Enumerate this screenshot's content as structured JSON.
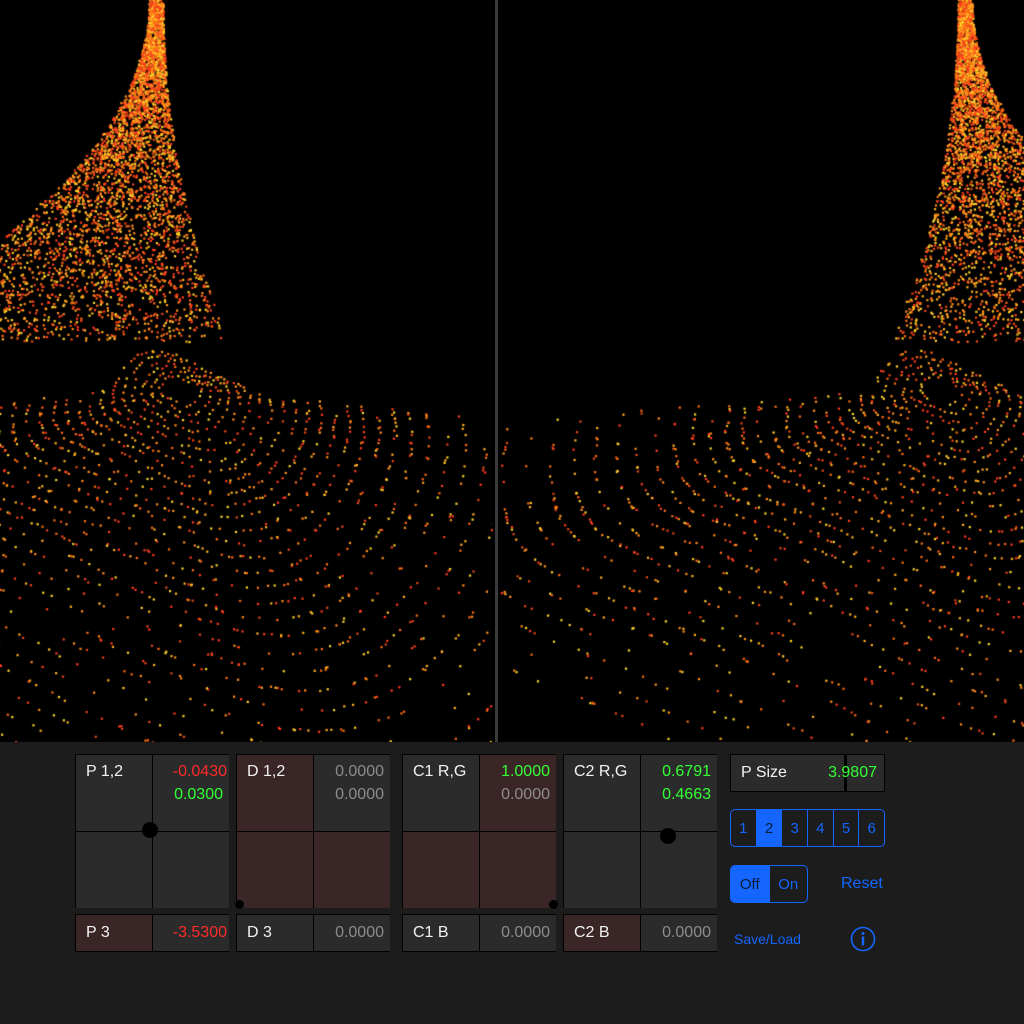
{
  "pads": [
    {
      "label": "P 1,2",
      "v1": "-0.0430",
      "v1_color": "#ff2a2a",
      "v2": "0.0300",
      "v2_color": "#33ff33",
      "tinted": false,
      "knob_x": 0.48,
      "knob_y": 0.5
    },
    {
      "label": "D 1,2",
      "v1": "0.0000",
      "v1_color": "#8c8c8c",
      "v2": "0.0000",
      "v2_color": "#8c8c8c",
      "tinted": true,
      "knob_x": 0.0,
      "knob_y": 1.0
    },
    {
      "label": "C1 R,G",
      "v1": "1.0000",
      "v1_color": "#33ff33",
      "v2": "0.0000",
      "v2_color": "#8c8c8c",
      "tinted": true,
      "knob_x": 1.0,
      "knob_y": 1.0
    },
    {
      "label": "C2 R,G",
      "v1": "0.6791",
      "v1_color": "#33ff33",
      "v2": "0.4663",
      "v2_color": "#33ff33",
      "tinted": false,
      "knob_x": 0.68,
      "knob_y": 0.53
    }
  ],
  "bars": [
    {
      "label": "P 3",
      "value": "-3.5300",
      "value_color": "#ff2a2a",
      "tinted": true
    },
    {
      "label": "D 3",
      "value": "0.0000",
      "value_color": "#8c8c8c",
      "tinted": false
    },
    {
      "label": "C1 B",
      "value": "0.0000",
      "value_color": "#8c8c8c",
      "tinted": false
    },
    {
      "label": "C2 B",
      "value": "0.0000",
      "value_color": "#8c8c8c",
      "tinted": true
    }
  ],
  "psize": {
    "label": "P Size",
    "value": "3.9807",
    "value_color": "#33ff33",
    "level": 0.8
  },
  "presets": {
    "options": [
      "1",
      "2",
      "3",
      "4",
      "5",
      "6"
    ],
    "selected": 1
  },
  "toggle": {
    "options": [
      "Off",
      "On"
    ],
    "selected": 0
  },
  "reset_label": "Reset",
  "saveload_label": "Save/Load",
  "info_icon": "info-icon",
  "colors": {
    "accent": "#1466ff",
    "positive": "#33ff33",
    "negative": "#ff2a2a",
    "neutral": "#8c8c8c",
    "panel": "#1c1c1c"
  }
}
